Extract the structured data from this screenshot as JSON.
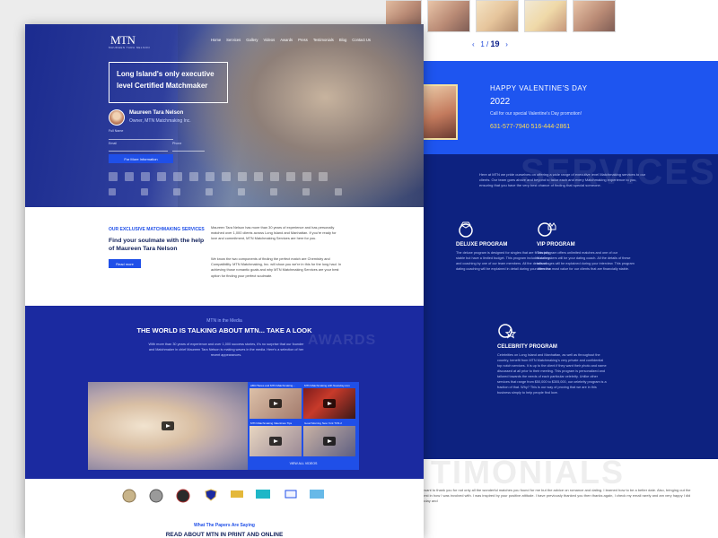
{
  "colors": {
    "accent": "#1f4fe8",
    "navy": "#1b2aa0",
    "dark": "#10205a"
  },
  "back": {
    "pager": {
      "prev": "‹",
      "page": "1",
      "sep": "/",
      "total": "19",
      "next": "›"
    },
    "vday": {
      "title": "HAPPY VALENTINE'S DAY",
      "year": "2022",
      "sub": "Call for our special Valentine's Day promotion!",
      "phones": "631-577-7940  516-444-2861"
    },
    "services_bg": "SERVICES",
    "services_intro": "Here at MTN we pride ourselves on offering a wide range of executive level Matchmaking services to our clients. Our team goes above and beyond to tailor each and every Matchmaking experience to you, ensuring that you have the very best chance of finding that special someone.",
    "deluxe": {
      "title": "DELUXE PROGRAM",
      "desc": "The deluxe program is designed for singles that are financially stable but have a limited budget. This program includes dating and coaching by one of our team members. All the details of dating coaching will be explained in detail during your interview."
    },
    "vip": {
      "title": "VIP PROGRAM",
      "desc": "This program offers unlimited matches and one of our Matchmakers will be your dating coach. All the details of these advantages will be explained during your interview. This program offers the most value for our clients that are financially stable."
    },
    "celebrity": {
      "title": "CELEBRITY PROGRAM",
      "desc": "Celebrities on Long Island and Manhattan, as well as throughout the country, benefit from MTN Matchmaking's very private and confidential top notch services. It is up to the client if they want their photo and name discussed at all prior to their meeting. This program is personalized and tailored towards the needs of each particular celebrity. Unlike other services that range from $50,000 to $305,000, our celebrity program is a fraction of that. Why? This is our way of proving that we are in this business simply to help people find love."
    },
    "left_partial": "ed for very financially stable singles ...",
    "testimonials_bg": "TIMONIALS",
    "testimonials_text": "I want to thank you for not only all the wonderful matches you found for me but the advice on romance and dating. I learned how to be a better date. Also, bringing out the best in how I was involved with. I was inspired by your positive attitude. I have previously thanked you then thanks again, I check my email rarely and am very happy I did today and"
  },
  "hero": {
    "logo": "MTN",
    "logo_sub": "MAUREEN TARA NELSON",
    "nav": [
      "Home",
      "Services",
      "Gallery",
      "Videos",
      "Awards",
      "Press",
      "Testimonials",
      "Blog",
      "Contact Us"
    ],
    "tagline_1": "Long Island's only executive",
    "tagline_2": "level Certified Matchmaker",
    "name": "Maureen Tara Nelson",
    "role": "Owner, MTN Matchmaking Inc.",
    "field_fullname": "Full Name",
    "field_email": "Email",
    "field_phone": "Phone",
    "cta": "For More Information"
  },
  "intro": {
    "kicker": "OUR EXCLUSIVE MATCHMAKING SERVICES",
    "heading": "Find your soulmate with the help of Maureen Tara Nelson",
    "button": "Read more",
    "p1": "Maureen Tara Nelson has more than 30 years of experience and has personally matched over 1,000 clients across Long Island and Manhattan. If you're ready for love and commitment, MTN Matchmaking Services are here for you.",
    "p2": "We know the two components of finding the perfect match are Chemistry and Compatibility. MTN Matchmaking, Inc. will show you we're in this for the long haul. In achieving those romantic goals and why MTN Matchmaking Services are your best option for finding your perfect soulmate."
  },
  "media": {
    "kicker": "MTN in the Media",
    "heading": "THE WORLD IS TALKING ABOUT MTN... TAKE A LOOK",
    "text": "With more than 30 years of experience and over 1,000 success stories, it's no surprise that our founder and Matchmaker in chief Maureen Tara Nelson is making waves in the media. Here's a selection of her recent appearances.",
    "awards_bg": "AWARDS",
    "videos": [
      "ABC7News and MTN Matchmaking...",
      "MTN Matchmaking with Newsday.com",
      "MTN Matchmaking Valentines Tips",
      "Good Morning New York TOS 2"
    ],
    "view_all": "VIEW ALL VIDEOS"
  },
  "papers": {
    "kicker": "What The Papers Are Saying",
    "heading": "READ ABOUT MTN IN PRINT AND ONLINE"
  }
}
